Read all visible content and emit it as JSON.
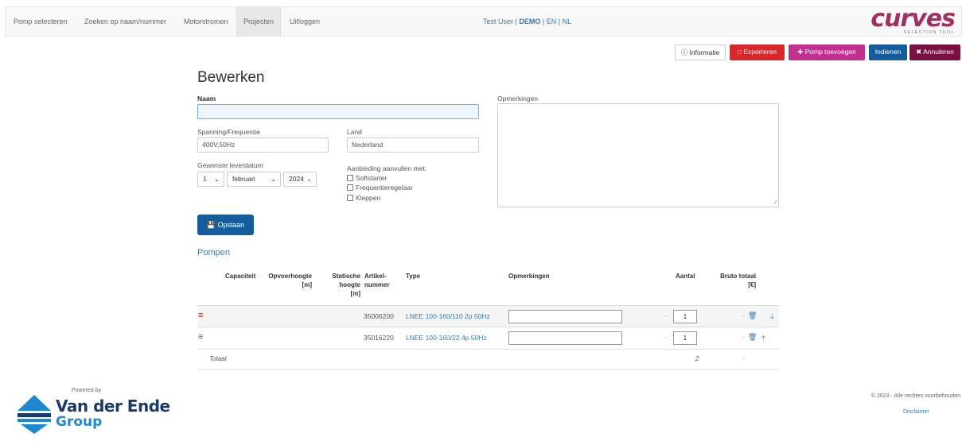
{
  "nav": {
    "items": [
      "Pomp selecteren",
      "Zoeken op naam/nummer",
      "Motorstromen",
      "Projecten",
      "Uitloggen"
    ],
    "user": "Test User",
    "sep1": "|",
    "demo": "DEMO",
    "sep2": "|",
    "lang_en": "EN",
    "sep3": "|",
    "lang_nl": "NL"
  },
  "logo": {
    "word": "curves",
    "sub": "SELECTION TOOL"
  },
  "actions": {
    "info": "Informatie",
    "export": "Exporteren",
    "add_pump": "Pomp toevoegen",
    "submit": "Indienen",
    "cancel": "Annuleren"
  },
  "form": {
    "title": "Bewerken",
    "name_label": "Naam",
    "name_value": "",
    "remarks_label": "Opmerkingen",
    "voltage_label": "Spanning/Frequentie",
    "voltage_value": "400V,50Hz",
    "country_label": "Land",
    "country_value": "Nederland",
    "date_label": "Gewenste leverdatum",
    "day": "1",
    "month": "februari",
    "year": "2024",
    "extras_label": "Aanbieding aanvullen met:",
    "extras": [
      "Softstarter",
      "Frequentieregelaar",
      "Kleppen"
    ],
    "save": "Opslaan"
  },
  "pumps": {
    "section_title": "Pompen",
    "headers": {
      "capacity": "Capaciteit",
      "head_1": "Opvoerhoogte",
      "head_2": "[m]",
      "static_1": "Statische",
      "static_2": "hoogte",
      "static_3": "[m]",
      "article_1": "Artikel-",
      "article_2": "nummer",
      "type": "Type",
      "remarks": "Opmerkingen",
      "qty": "Aantal",
      "gross_1": "Bruto totaal",
      "gross_2": "[€]"
    },
    "rows": [
      {
        "article": "35006200",
        "type": "LNEE 100-160/110 2p 50Hz",
        "qty": "1",
        "dash": "-",
        "total": "-"
      },
      {
        "article": "35016220",
        "type": "LNEE 100-160/22 4p 50Hz",
        "qty": "1",
        "dash": "-",
        "total": "-"
      }
    ],
    "total_label": "Totaal",
    "total_qty": "2",
    "total_gross": "-"
  },
  "footer": {
    "powered_by": "Powered by",
    "brand_1": "Van der Ende",
    "brand_2": "Group",
    "copyright": "© 2023 - Alle rechten voorbehouden",
    "disclaimer": "Disclaimer"
  },
  "colors": {
    "link": "#337ab7",
    "primary": "#155c9c",
    "danger": "#d9262b",
    "pink": "#c2308f",
    "purple": "#7a0f43",
    "logo": "#a0305f"
  }
}
